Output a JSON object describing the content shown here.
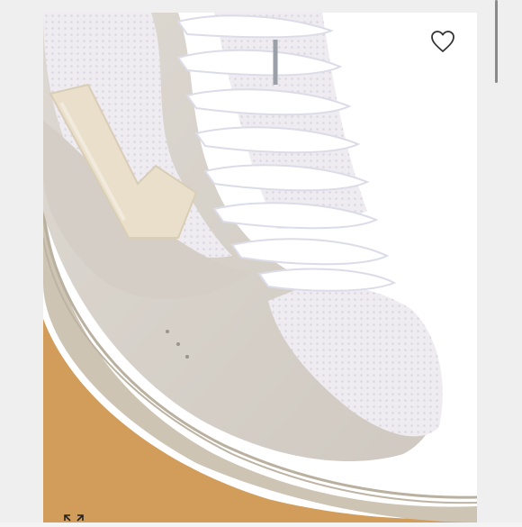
{
  "viewer": {
    "image_subject": "sneaker-photo",
    "brand_mark": "V",
    "actions": {
      "favorite_icon": "heart-outline-icon",
      "expand_icon": "expand-arrows-icon"
    }
  },
  "colors": {
    "background": "#efefef",
    "photo_bg": "#ffffff",
    "suede": "#d8d3cc",
    "mesh": "#ece9ee",
    "logo": "#e8dcc6",
    "laces": "#ffffff",
    "sole": "#cfc7b8",
    "gum": "#d19a57"
  }
}
